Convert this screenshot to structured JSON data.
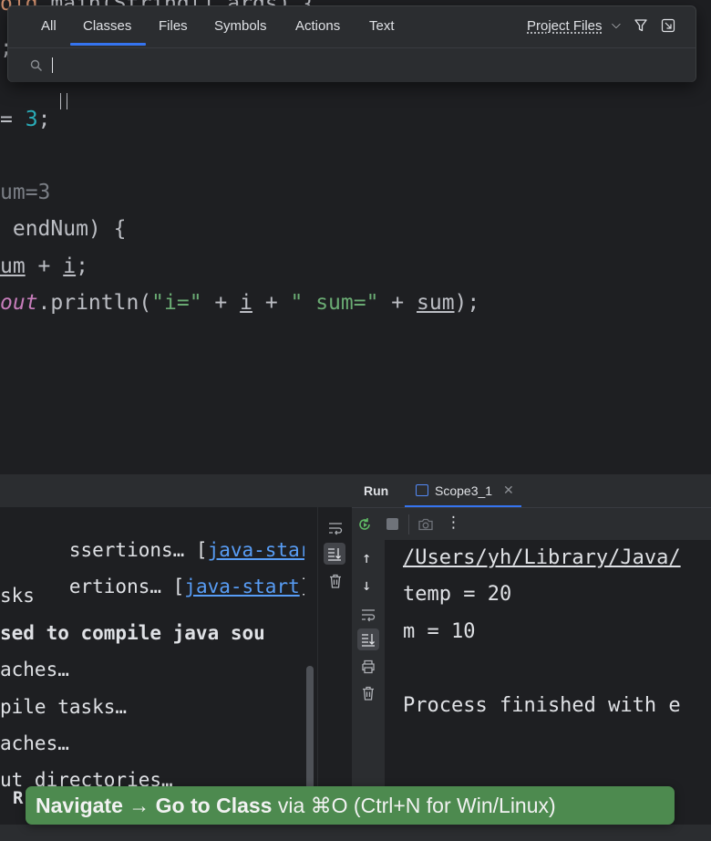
{
  "popup": {
    "tabs": [
      "All",
      "Classes",
      "Files",
      "Symbols",
      "Actions",
      "Text"
    ],
    "active_tab": "Classes",
    "scope_label": "Project Files",
    "search_value": ""
  },
  "editor": {
    "lines": [
      {
        "parts": [
          [
            "kw",
            "oid "
          ],
          [
            "plain",
            "main(String[] args) {"
          ]
        ]
      },
      {
        "parts": [
          [
            "plain",
            ";"
          ]
        ]
      },
      {
        "parts": [
          [
            "plain",
            "= "
          ],
          [
            "num",
            "3"
          ],
          [
            "plain",
            ";"
          ]
        ]
      },
      {
        "parts": [
          [
            "hint",
            "um=3"
          ]
        ]
      },
      {
        "parts": [
          [
            "plain",
            " endNum) {"
          ]
        ]
      },
      {
        "parts": [
          [
            "ul",
            "um"
          ],
          [
            "plain",
            " + "
          ],
          [
            "ul",
            "i"
          ],
          [
            "plain",
            ";"
          ]
        ]
      },
      {
        "parts": [
          [
            "static",
            "out"
          ],
          [
            "plain",
            ".println("
          ],
          [
            "str",
            "\"i=\""
          ],
          [
            "plain",
            " + "
          ],
          [
            "ul",
            "i"
          ],
          [
            "plain",
            " + "
          ],
          [
            "str",
            "\" sum=\""
          ],
          [
            "plain",
            " + "
          ],
          [
            "ul",
            "sum"
          ],
          [
            "plain",
            ");"
          ]
        ]
      }
    ]
  },
  "build": {
    "lines": [
      {
        "text": "ssertions… [",
        "link": "java-start",
        "after": "]",
        "bold": false
      },
      {
        "text": "ertions… [",
        "link": "java-start",
        "after": "]",
        "bold": false
      },
      {
        "text": "sks",
        "bold": false
      },
      {
        "text": "sed to compile java sou",
        "bold": true
      },
      {
        "text": "aches…",
        "bold": false
      },
      {
        "text": "pile tasks…",
        "bold": false
      },
      {
        "text": "aches…",
        "bold": false
      },
      {
        "text": "ut directories…",
        "bold": false
      }
    ],
    "strip_letter": "R"
  },
  "run": {
    "title": "Run",
    "tab_label": "Scope3_1",
    "console": [
      {
        "text": "/Users/yh/Library/Java/",
        "link": true
      },
      {
        "text": "temp = 20",
        "link": false
      },
      {
        "text": "m = 10",
        "link": false
      },
      {
        "text": "",
        "link": false
      },
      {
        "text": "Process finished with e",
        "link": false
      }
    ]
  },
  "tooltip": {
    "part1": "Navigate → Go to Class",
    "part2": " via ",
    "part3": "⌘O",
    "part4": " (Ctrl+N for Win/Linux)"
  },
  "colors": {
    "accent": "#3574f0",
    "tooltip_bg": "#4d8a4f",
    "editor_bg": "#1e1f22",
    "panel_bg": "#2b2d30"
  }
}
